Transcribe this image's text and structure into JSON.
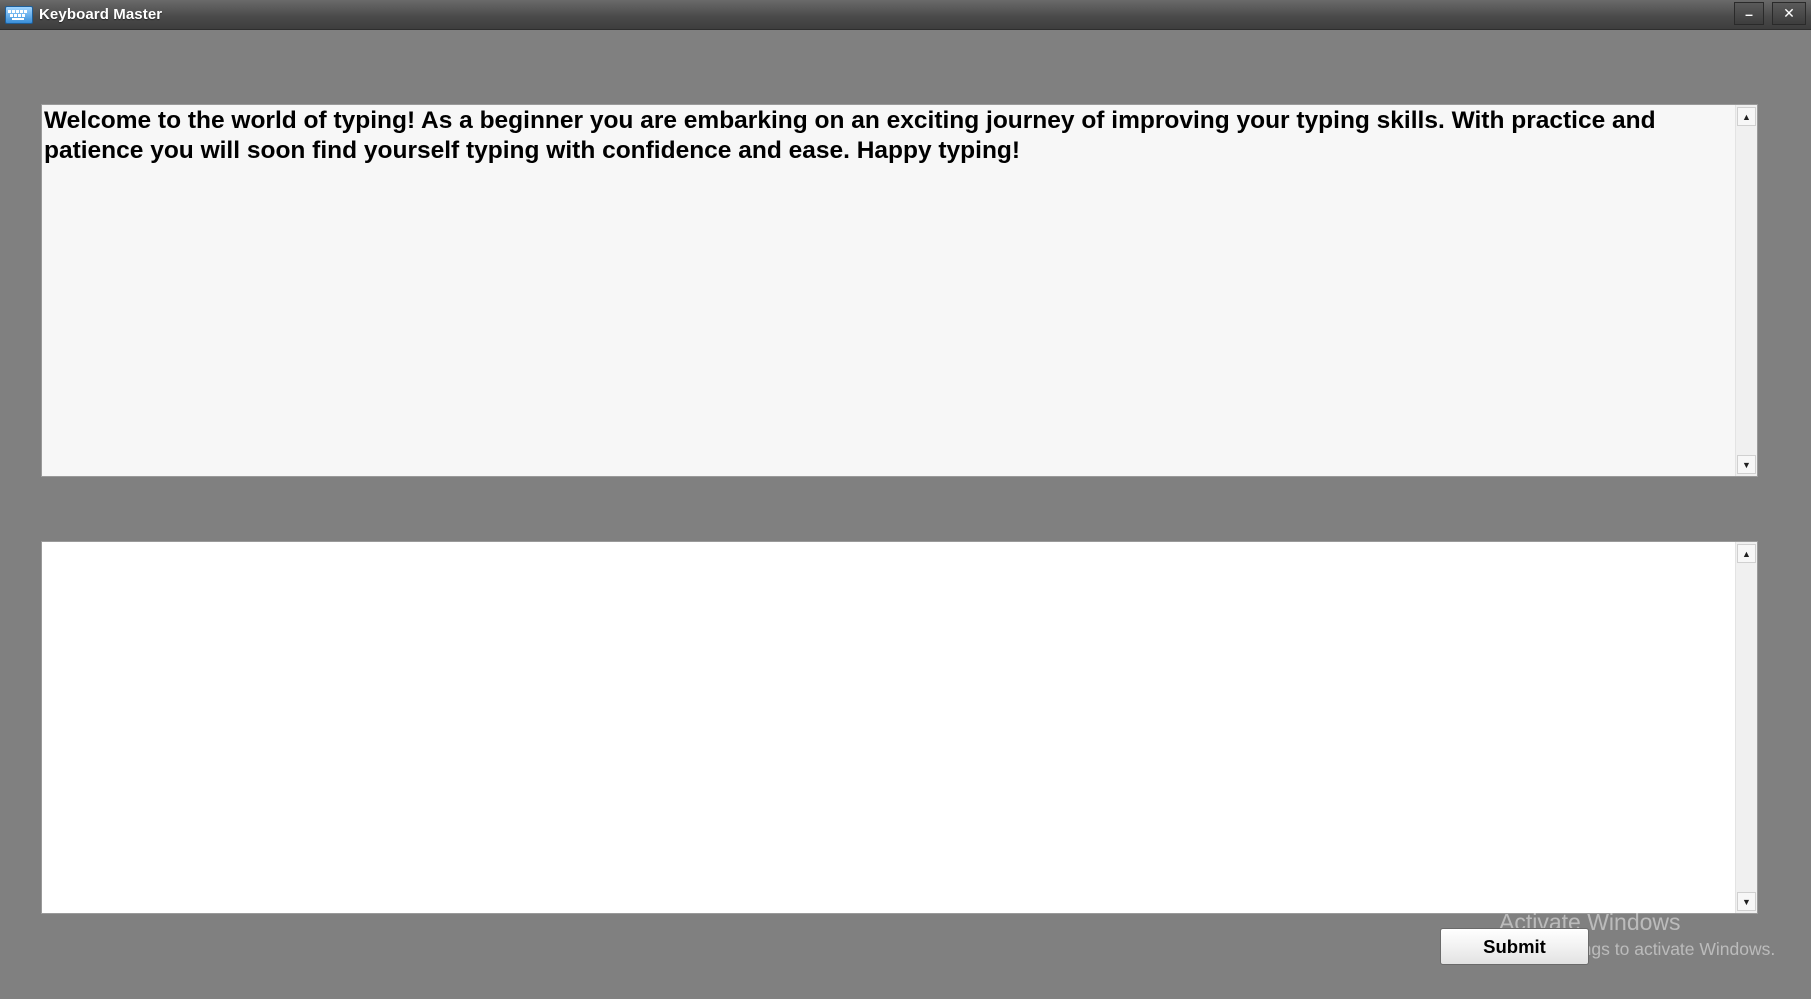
{
  "window": {
    "title": "Keyboard Master",
    "minimize_glyph": "–",
    "close_glyph": "✕"
  },
  "source_text": "Welcome to the world of typing! As a beginner you are embarking on an exciting journey of improving your typing skills. With practice and patience you will soon find yourself typing with confidence and ease. Happy typing!",
  "typing_input": {
    "value": "",
    "placeholder": ""
  },
  "scrollbar": {
    "up_glyph": "▲",
    "down_glyph": "▼"
  },
  "submit_label": "Submit",
  "watermark": {
    "title": "Activate Windows",
    "subtitle": "Go to Settings to activate Windows."
  },
  "colors": {
    "background": "#808080",
    "titlebar": "#4b4b4b",
    "source_box": "#f7f7f7",
    "input_box": "#ffffff"
  },
  "icons": {
    "app": "keyboard-icon"
  }
}
